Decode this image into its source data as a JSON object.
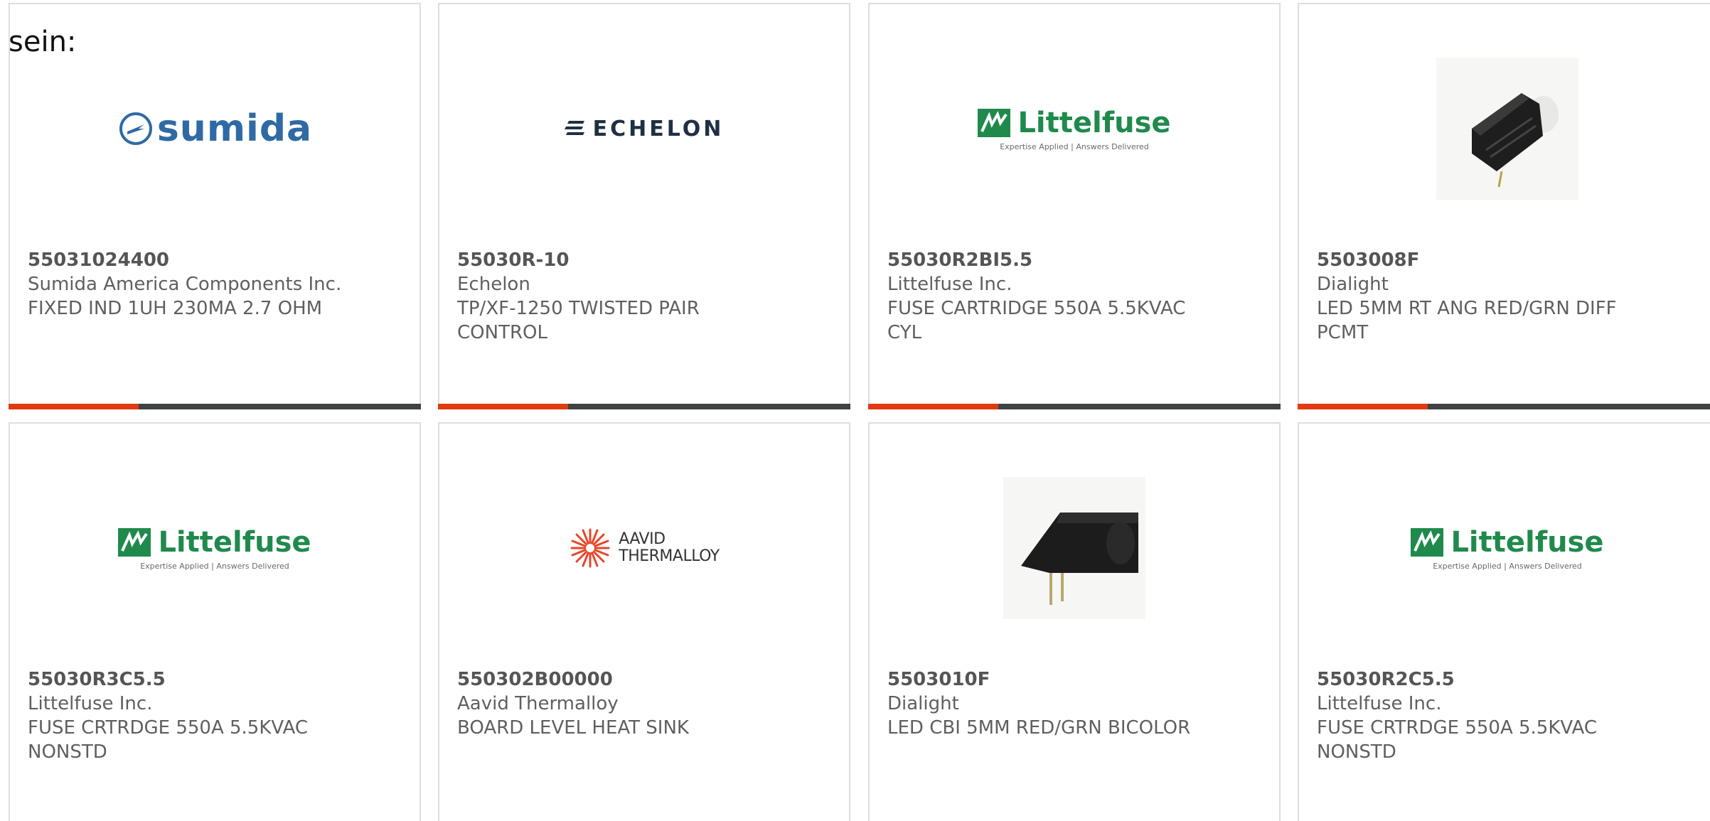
{
  "intro_text": "sein:",
  "colors": {
    "accent": "#e23a10",
    "bar_dark": "#404344",
    "card_border": "#dedede"
  },
  "cards": [
    {
      "part_number": "55031024400",
      "manufacturer": "Sumida America Components Inc.",
      "description": "FIXED IND 1UH 230MA 2.7 OHM",
      "logo": {
        "type": "sumida-logo",
        "text": "sumida"
      }
    },
    {
      "part_number": "55030R-10",
      "manufacturer": "Echelon",
      "description": "TP/XF-1250 TWISTED PAIR CONTROL",
      "logo": {
        "type": "echelon-logo",
        "text": "ECHELON"
      }
    },
    {
      "part_number": "55030R2BI5.5",
      "manufacturer": "Littelfuse Inc.",
      "description": "FUSE CARTRIDGE 550A 5.5KVAC CYL",
      "logo": {
        "type": "littelfuse-logo",
        "text": "Littelfuse",
        "tagline": "Expertise Applied | Answers Delivered"
      }
    },
    {
      "part_number": "5503008F",
      "manufacturer": "Dialight",
      "description": "LED 5MM RT ANG RED/GRN DIFF PCMT",
      "logo": {
        "type": "led-right-angle-photo"
      }
    },
    {
      "part_number": "55030R3C5.5",
      "manufacturer": "Littelfuse Inc.",
      "description": "FUSE CRTRDGE 550A 5.5KVAC NONSTD",
      "logo": {
        "type": "littelfuse-logo",
        "text": "Littelfuse",
        "tagline": "Expertise Applied | Answers Delivered"
      }
    },
    {
      "part_number": "550302B00000",
      "manufacturer": "Aavid Thermalloy",
      "description": "BOARD LEVEL HEAT SINK",
      "logo": {
        "type": "aavid-logo",
        "text_line1": "AAVID",
        "text_line2": "THERMALLOY"
      }
    },
    {
      "part_number": "5503010F",
      "manufacturer": "Dialight",
      "description": "LED CBI 5MM RED/GRN BICOLOR",
      "logo": {
        "type": "led-cbi-photo"
      }
    },
    {
      "part_number": "55030R2C5.5",
      "manufacturer": "Littelfuse Inc.",
      "description": "FUSE CRTRDGE 550A 5.5KVAC NONSTD",
      "logo": {
        "type": "littelfuse-logo",
        "text": "Littelfuse",
        "tagline": "Expertise Applied | Answers Delivered"
      }
    }
  ]
}
